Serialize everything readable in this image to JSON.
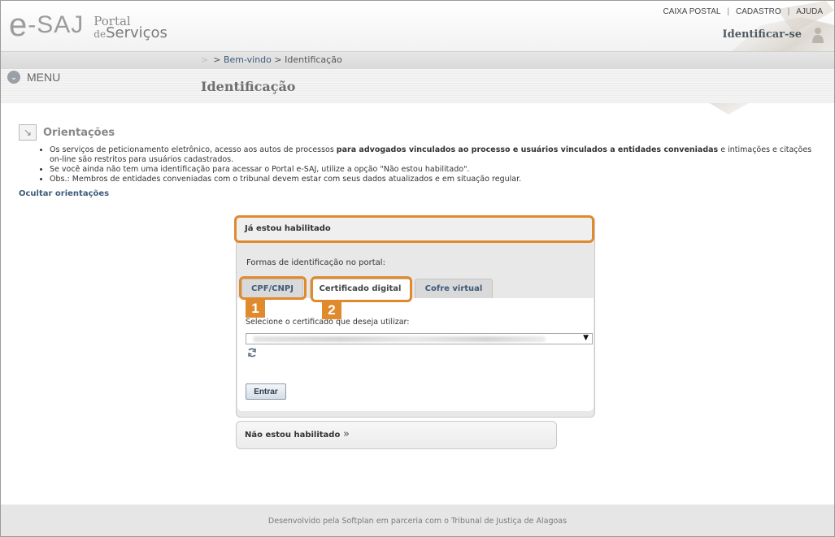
{
  "header": {
    "logo_e": "e",
    "logo_saj": "-SAJ",
    "logo_portal": "Portal",
    "logo_de": "de",
    "logo_servicos": "Serviços",
    "top_links": [
      "CAIXA POSTAL",
      "CADASTRO",
      "AJUDA"
    ],
    "separator": "|",
    "identify_label": "Identificar-se"
  },
  "nav": {
    "breadcrumb_arrow": ">",
    "breadcrumb_welcome": "Bem-vindo",
    "breadcrumb_sep": ">",
    "breadcrumb_current": "Identificação",
    "menu_label": "MENU",
    "menu_icon": "chevron-down-icon",
    "page_title": "Identificação"
  },
  "orientacoes": {
    "title": "Orientações",
    "icon": "arrow-down-right-icon",
    "item1_pre": "Os serviços de peticionamento eletrônico, acesso aos autos de processos ",
    "item1_bold": "para advogados vinculados ao processo e usuários vinculados a entidades conveniadas",
    "item1_post": " e intimações e citações on-line são restritos para usuários cadastrados.",
    "item2": "Se você ainda não tem uma identificação para acessar o Portal e-SAJ, utilize a opção \"Não estou habilitado\".",
    "item3": "Obs.: Membros de entidades conveniadas com o tribunal devem estar com seus dados atualizados e em situação regular.",
    "hide_link": "Ocultar orientações"
  },
  "login": {
    "header": "Já estou habilitado",
    "forms_label": "Formas de identificação no portal:",
    "tabs": [
      "CPF/CNPJ",
      "Certificado digital",
      "Cofre virtual"
    ],
    "active_tab": "Certificado digital",
    "badges": [
      "1",
      "2"
    ],
    "select_label": "Selecione o certificado que deseja utilizar:",
    "select_arrow": "▼",
    "enter_button": "Entrar",
    "highlight_color": "#e08a2e"
  },
  "not_enabled": {
    "label": "Não estou habilitado",
    "chevron": "»"
  },
  "footer": {
    "text": "Desenvolvido pela Softplan em parceria com o Tribunal de Justiça de Alagoas"
  }
}
